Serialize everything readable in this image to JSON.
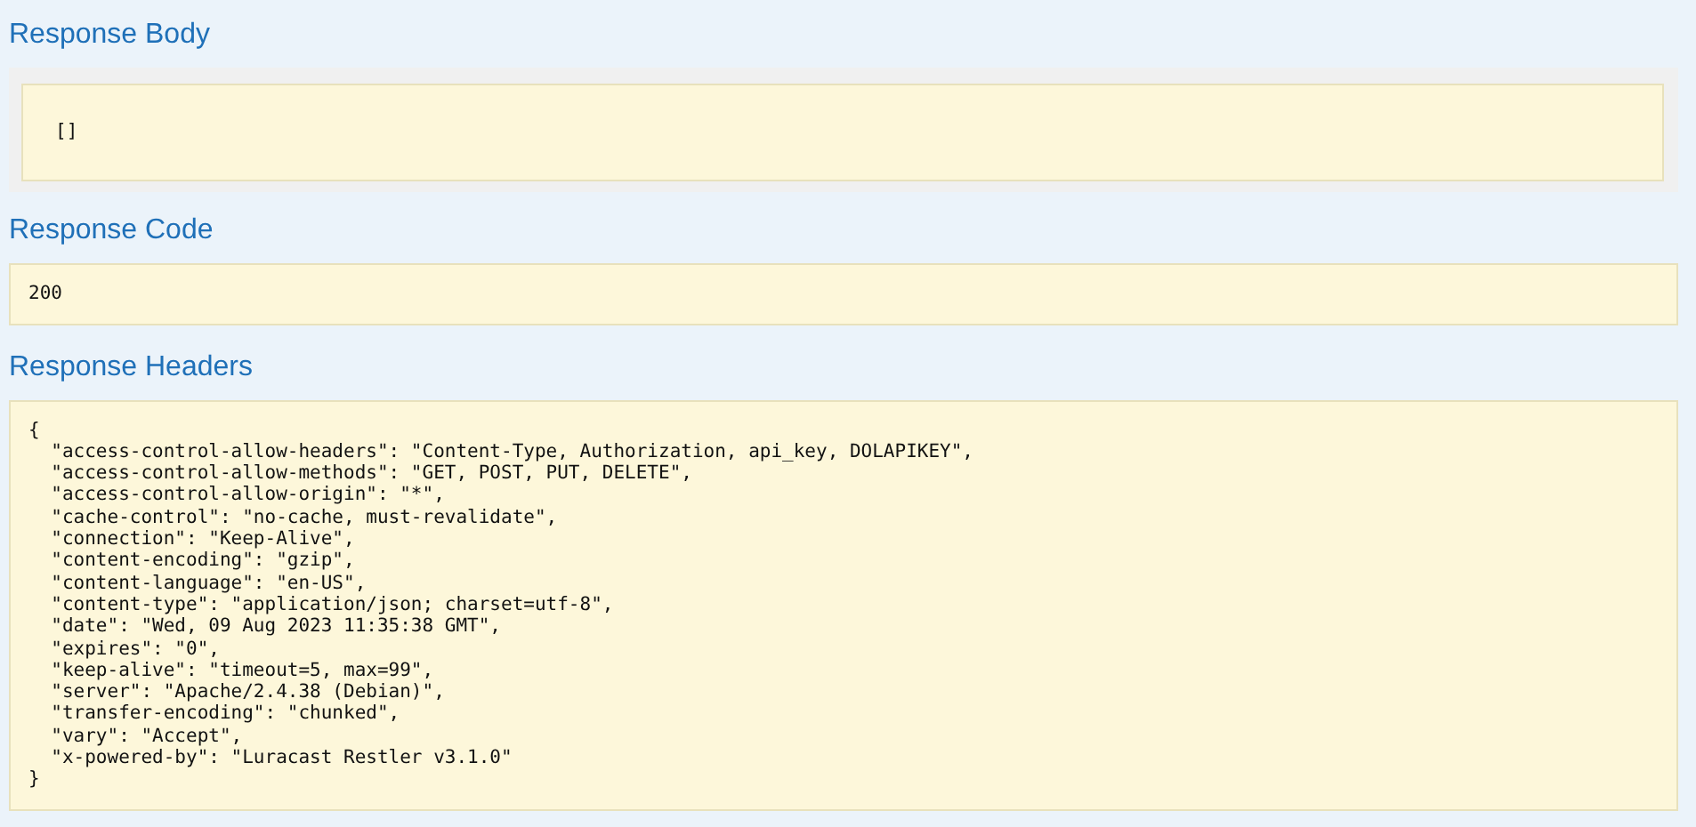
{
  "sections": [
    {
      "title": "Response Body",
      "kind": "wrapped",
      "content": "[]"
    },
    {
      "title": "Response Code",
      "kind": "plain",
      "content": "200"
    },
    {
      "title": "Response Headers",
      "kind": "plain",
      "content": "{\n  \"access-control-allow-headers\": \"Content-Type, Authorization, api_key, DOLAPIKEY\",\n  \"access-control-allow-methods\": \"GET, POST, PUT, DELETE\",\n  \"access-control-allow-origin\": \"*\",\n  \"cache-control\": \"no-cache, must-revalidate\",\n  \"connection\": \"Keep-Alive\",\n  \"content-encoding\": \"gzip\",\n  \"content-language\": \"en-US\",\n  \"content-type\": \"application/json; charset=utf-8\",\n  \"date\": \"Wed, 09 Aug 2023 11:35:38 GMT\",\n  \"expires\": \"0\",\n  \"keep-alive\": \"timeout=5, max=99\",\n  \"server\": \"Apache/2.4.38 (Debian)\",\n  \"transfer-encoding\": \"chunked\",\n  \"vary\": \"Accept\",\n  \"x-powered-by\": \"Luracast Restler v3.1.0\"\n}"
    }
  ]
}
